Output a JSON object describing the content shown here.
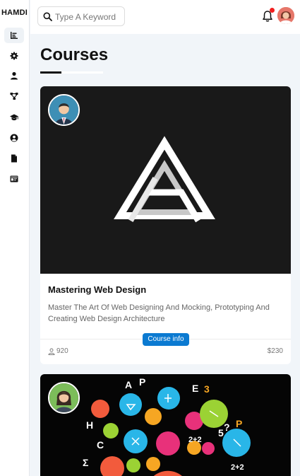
{
  "brand": "HAMDI",
  "search": {
    "placeholder": "Type A Keyword"
  },
  "header": {
    "notification_icon": "bell-icon",
    "has_notification": true
  },
  "sidebar": {
    "items": [
      {
        "icon": "chart-bar-icon",
        "active": true
      },
      {
        "icon": "gear-icon",
        "active": false
      },
      {
        "icon": "user-icon",
        "active": false
      },
      {
        "icon": "diagram-icon",
        "active": false
      },
      {
        "icon": "graduation-cap-icon",
        "active": false
      },
      {
        "icon": "user-circle-icon",
        "active": false
      },
      {
        "icon": "file-icon",
        "active": false
      },
      {
        "icon": "id-card-icon",
        "active": false
      }
    ]
  },
  "page": {
    "title": "Courses"
  },
  "courses": [
    {
      "title": "Mastering Web Design",
      "description": "Master The Art Of Web Designing And Mocking, Prototyping And Creating Web Design Architecture",
      "button": "Course info",
      "students": "920",
      "price": "$230"
    },
    {}
  ],
  "colors": {
    "accent": "#0b7ad1",
    "notification": "#f11f1f",
    "background": "#f1f5f9"
  }
}
